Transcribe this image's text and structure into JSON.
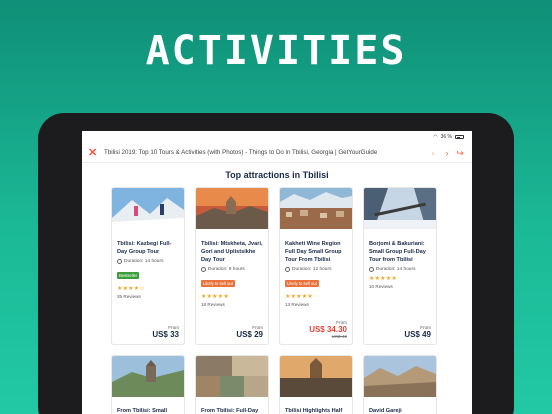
{
  "headline": "ACTIVITIES",
  "status": {
    "signal": "▪▪",
    "battery": "36 %"
  },
  "browser": {
    "close_icon": "close-icon",
    "page_title": "Tbilisi 2019: Top 10 Tours & Activities (with Photos) - Things to Do in Tbilisi, Georgia | GetYourGuide",
    "back_icon": "‹",
    "forward_icon": "›",
    "share_icon": "↪"
  },
  "section_title": "Top attractions in Tbilisi",
  "cards": [
    {
      "title": "Tbilisi: Kazbegi Full-Day Group Tour",
      "duration": "Duration: 14 hours",
      "badge": "Bestseller",
      "stars": "★★★★☆",
      "rating_value": 4.5,
      "reviews": "35 Reviews",
      "from": "From",
      "price": "US$ 33",
      "old_price": ""
    },
    {
      "title": "Tbilisi: Mtskheta, Jvari, Gori and Uplistsikhe Day Tour",
      "duration": "Duration: 9 hours",
      "badge": "Likely to sell out",
      "stars": "★★★★★",
      "rating_value": 5,
      "reviews": "18 Reviews",
      "from": "From",
      "price": "US$ 29",
      "old_price": ""
    },
    {
      "title": "Kakheti Wine Region Full Day Small Group Tour From Tbilisi",
      "duration": "Duration: 12 hours",
      "badge": "Likely to sell out",
      "stars": "★★★★★",
      "rating_value": 5,
      "reviews": "13 Reviews",
      "from": "From",
      "price": "US$ 34.30",
      "old_price": "US$ 49"
    },
    {
      "title": "Borjomi & Bakuriani: Small Group Full-Day Tour from Tbilisi",
      "duration": "Duration: 14 hours",
      "badge": "",
      "stars": "★★★★★",
      "rating_value": 5,
      "reviews": "10 Reviews",
      "from": "From",
      "price": "US$ 49",
      "old_price": ""
    }
  ],
  "second_row": [
    {
      "title": "From Tbilisi: Small"
    },
    {
      "title": "From Tbilisi: Full-Day"
    },
    {
      "title": "Tbilisi Highlights Half"
    },
    {
      "title": "David Gareji"
    }
  ],
  "colors": {
    "accent": "#ff5533",
    "background_top": "#0f8f77",
    "background_bottom": "#22c9a4",
    "heading": "#1a2b49",
    "sale": "#e8433c",
    "bestseller": "#3d9d3d",
    "sell_out": "#e8733c",
    "stars": "#f5a623"
  }
}
